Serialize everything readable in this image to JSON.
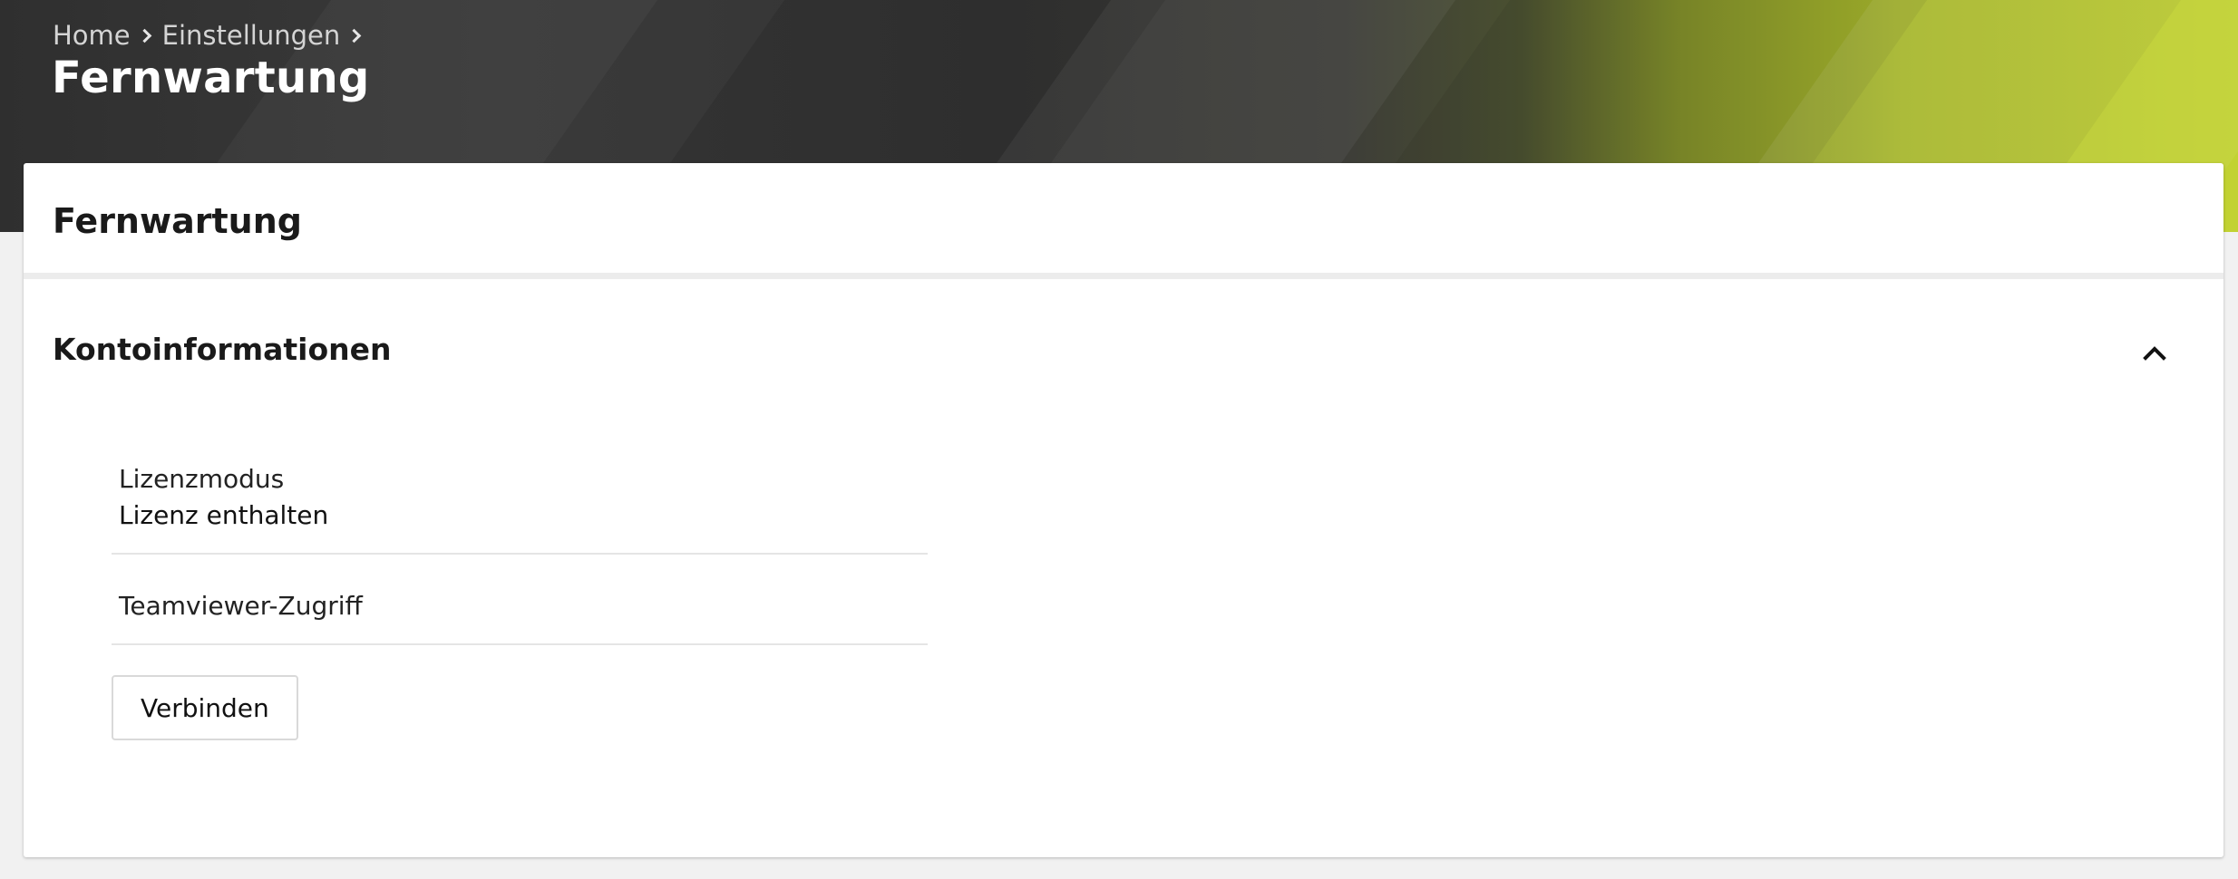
{
  "breadcrumb": {
    "items": [
      "Home",
      "Einstellungen"
    ]
  },
  "header": {
    "title": "Fernwartung"
  },
  "card": {
    "title": "Fernwartung",
    "section": {
      "title": "Kontoinformationen",
      "toggle_icon": "chevron-up-icon",
      "fields": [
        {
          "label": "Lizenzmodus",
          "value": "Lizenz enthalten"
        },
        {
          "label": "Teamviewer-Zugriff",
          "value": ""
        }
      ],
      "button_label": "Verbinden"
    }
  },
  "colors": {
    "banner_dark": "#333333",
    "banner_accent": "#bac92e",
    "page_background": "#f1f1f1",
    "card_background": "#ffffff"
  }
}
